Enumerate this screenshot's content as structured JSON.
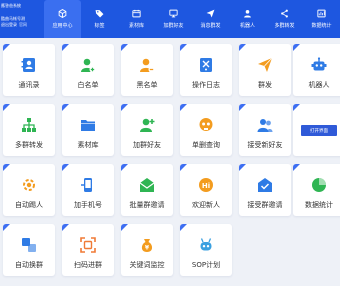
{
  "app": {
    "title": "應答爸系統",
    "subtitle": "酷曲马帐号测",
    "link_1": "退出登录",
    "link_2": "官网"
  },
  "nav": [
    {
      "label": "应用中心",
      "icon": "cube-icon",
      "active": true
    },
    {
      "label": "标签",
      "icon": "tag-icon"
    },
    {
      "label": "素材库",
      "icon": "calendar-icon"
    },
    {
      "label": "加群好友",
      "icon": "monitor-icon"
    },
    {
      "label": "消息群发",
      "icon": "send-icon"
    },
    {
      "label": "机器人",
      "icon": "user-icon"
    },
    {
      "label": "多群转发",
      "icon": "share-icon"
    },
    {
      "label": "数据统计",
      "icon": "chart-icon"
    }
  ],
  "apps": [
    {
      "label": "通讯录",
      "icon": "contacts-icon",
      "color": "#2f7be5"
    },
    {
      "label": "白名单",
      "icon": "user-add-icon",
      "color": "#2fb553"
    },
    {
      "label": "黑名单",
      "icon": "user-remove-icon",
      "color": "#f39c1f"
    },
    {
      "label": "操作日志",
      "icon": "settings-doc-icon",
      "color": "#2f7be5"
    },
    {
      "label": "群发",
      "icon": "paper-plane-icon",
      "color": "#f39c1f"
    },
    {
      "label": "机器人",
      "icon": "robot-icon",
      "color": "#2f7be5"
    },
    {
      "label": "多群转发",
      "icon": "network-icon",
      "color": "#2fb553"
    },
    {
      "label": "素材库",
      "icon": "folder-icon",
      "color": "#2f7be5"
    },
    {
      "label": "加群好友",
      "icon": "user-plus-icon",
      "color": "#2fb553"
    },
    {
      "label": "单删查询",
      "icon": "skull-icon",
      "color": "#f39c1f"
    },
    {
      "label": "接受新好友",
      "icon": "users-icon",
      "color": "#2f7be5"
    },
    {
      "label": "",
      "icon": "",
      "color": "#2f5ad8",
      "button": "打开界面"
    },
    {
      "label": "自动踢人",
      "icon": "kick-icon",
      "color": "#f39c1f"
    },
    {
      "label": "加手机号",
      "icon": "phone-add-icon",
      "color": "#2f7be5"
    },
    {
      "label": "批量群邀请",
      "icon": "mail-open-icon",
      "color": "#2fb553"
    },
    {
      "label": "欢迎新人",
      "icon": "hi-bubble-icon",
      "color": "#f39c1f"
    },
    {
      "label": "接受群邀请",
      "icon": "mail-accept-icon",
      "color": "#2f7be5"
    },
    {
      "label": "数据统计",
      "icon": "pie-chart-icon",
      "color": "#2fb553"
    },
    {
      "label": "自动换群",
      "icon": "swap-icon",
      "color": "#2f7be5"
    },
    {
      "label": "扫码进群",
      "icon": "qr-scan-icon",
      "color": "#f07a35"
    },
    {
      "label": "关键词监控",
      "icon": "money-bag-icon",
      "color": "#f39c1f"
    },
    {
      "label": "SOP计划",
      "icon": "sop-robot-icon",
      "color": "#3aa0e0"
    }
  ]
}
